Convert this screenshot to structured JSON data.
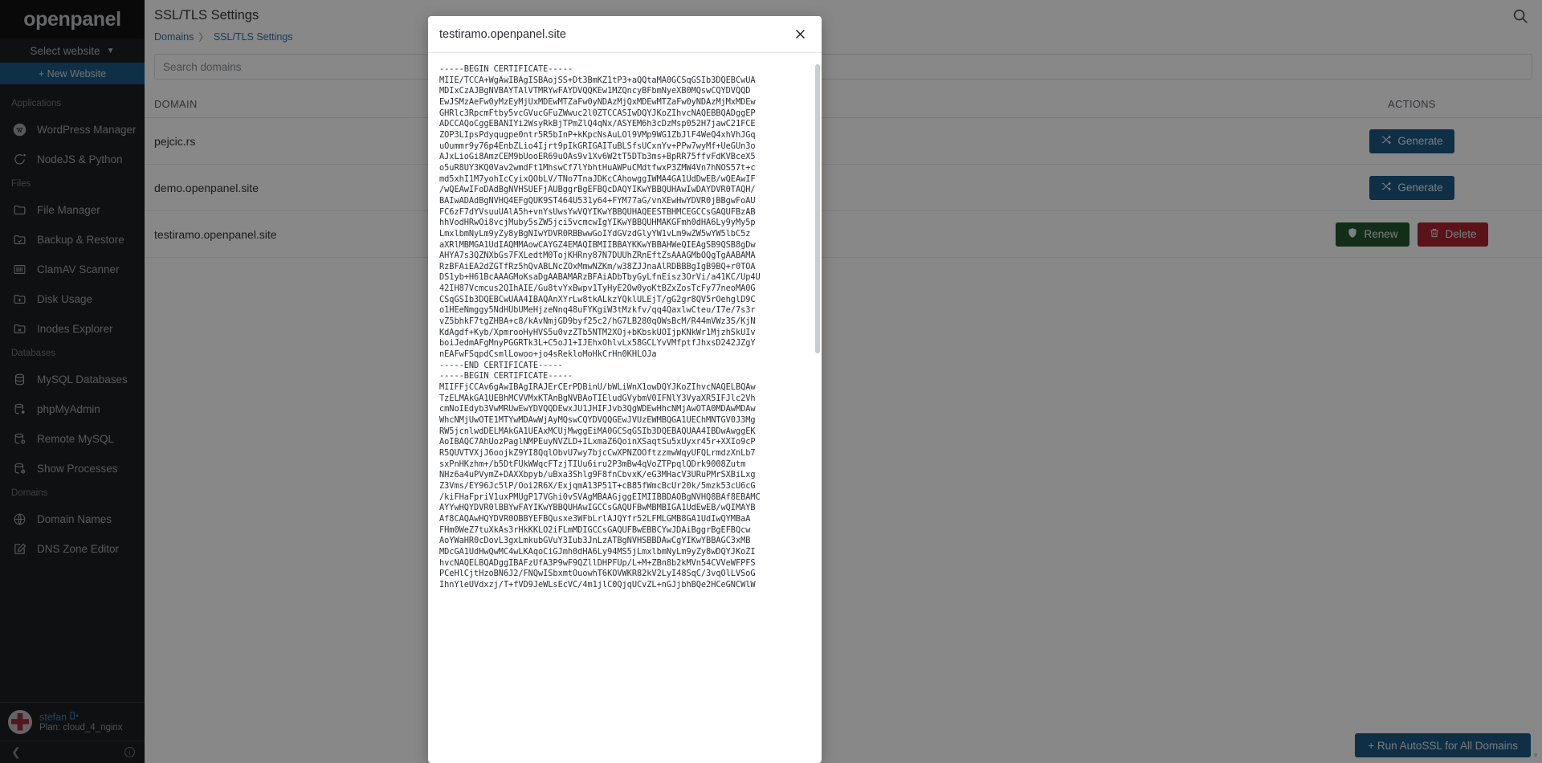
{
  "brand": {
    "name": "openpanel"
  },
  "sidebar": {
    "select_website": "Select website",
    "new_website": "+ New Website",
    "groups": [
      {
        "label": "Applications",
        "items": [
          {
            "label": "WordPress Manager",
            "icon": "wordpress-icon"
          },
          {
            "label": "NodeJS & Python",
            "icon": "nodejs-icon"
          }
        ]
      },
      {
        "label": "Files",
        "items": [
          {
            "label": "File Manager",
            "icon": "folder-icon"
          },
          {
            "label": "Backup & Restore",
            "icon": "folder-check-icon"
          },
          {
            "label": "ClamAV Scanner",
            "icon": "scan-icon"
          },
          {
            "label": "Disk Usage",
            "icon": "folder-plus-icon"
          },
          {
            "label": "Inodes Explorer",
            "icon": "folder-x-icon"
          }
        ]
      },
      {
        "label": "Databases",
        "items": [
          {
            "label": "MySQL Databases",
            "icon": "database-icon"
          },
          {
            "label": "phpMyAdmin",
            "icon": "database-gear-icon"
          },
          {
            "label": "Remote MySQL",
            "icon": "database-alert-icon"
          },
          {
            "label": "Show Processes",
            "icon": "database-ban-icon"
          }
        ]
      },
      {
        "label": "Domains",
        "items": [
          {
            "label": "Domain Names",
            "icon": "globe-icon"
          },
          {
            "label": "DNS Zone Editor",
            "icon": "edit-square-icon"
          }
        ]
      }
    ],
    "user": {
      "name": "stefan",
      "plan": "Plan: cloud_4_nginx",
      "logout_icon": "logout-icon"
    },
    "collapse_icon": "chevron-left-icon",
    "info_icon": "info-icon"
  },
  "header": {
    "title": "SSL/TLS Settings",
    "breadcrumb": [
      "Domains",
      "SSL/TLS Settings"
    ],
    "breadcrumb_separator": "〉",
    "search_icon": "search-icon"
  },
  "search": {
    "placeholder": "Search domains",
    "value": ""
  },
  "table": {
    "columns": [
      "DOMAIN",
      "ACTIONS"
    ],
    "rows": [
      {
        "domain": "pejcic.rs",
        "actions": [
          {
            "label": "Generate",
            "type": "generate",
            "icon": "shuffle-icon"
          }
        ]
      },
      {
        "domain": "demo.openpanel.site",
        "actions": [
          {
            "label": "Generate",
            "type": "generate",
            "icon": "shuffle-icon"
          }
        ]
      },
      {
        "domain": "testiramo.openpanel.site",
        "actions": [
          {
            "label": "Renew",
            "type": "renew",
            "icon": "shield-icon"
          },
          {
            "label": "Delete",
            "type": "delete",
            "icon": "trash-icon"
          }
        ]
      }
    ]
  },
  "footer": {
    "autossl_label": "+ Run AutoSSL for All Domains"
  },
  "modal": {
    "title": "testiramo.openpanel.site",
    "close_icon": "close-icon",
    "certificate": "-----BEGIN CERTIFICATE-----\nMIIE/TCCA+WgAwIBAgISBAojSS+Dt3BmKZ1tP3+aQQtaMA0GCSqGSIb3DQEBCwUA\nMDIxCzAJBgNVBAYTAlVTMRYwFAYDVQQKEw1MZQncyBFbmNyeXB0MQswCQYDVQQD\nEwJSMzAeFw0yMzEyMjUxMDEwMTZaFw0yNDAzMjQxMDEwMTZaFw0yNDAzMjMxMDEw\nGHRlc3RpcmFtby5vcGVucGFuZWwuc2l0ZTCCASIwDQYJKoZIhvcNAQEBBQADggEP\nADCCAQoCggEBANIYi2WsyRkBjTPmZlQ4qNx/ASYEM6h3cDzMsp052H7jawC21FCE\nZOP3LIpsPdyqugpe0ntr5R5bInP+kKpcNsAuLOl9VMp9WG1ZbJlF4WeQ4xhVhJGq\nuOummr9y76p4EnbZLio4Ijrt9pIkGRIGAITuBLSfsUCxnYv+PPw7wyMf+UeGUn3o\nAJxLioGi8AmzCEM9bUooER69uOAs9v1Xv6W2tT5DTb3ms+BpRR75ffvFdKVBceX5\no5uR8UY3KQ0Vav2wmdFt1MhswCf7lYbhtHuAWPuCMdtfwxP3ZMW4Vn7hNOS57t+c\nmd5xhI1M7yohIcCyixQObLV/TNo7TnaJDKcCAhowggIWMA4GA1UdDwEB/wQEAwIF\n/wQEAwIFoDAdBgNVHSUEFjAUBggrBgEFBQcDAQYIKwYBBQUHAwIwDAYDVR0TAQH/\nBAIwADAdBgNVHQ4EFgQUK9ST464U531y64+FYM77aG/vnXEwHwYDVR0jBBgwFoAU\nFC6zF7dYVsuuUAlA5h+vnYsUwsYwVQYIKwYBBQUHAQEESTBHMCEGCCsGAQUFBzAB\nhhVodHRwOi8vcjMuby5sZW5jci5vcmcwIgYIKwYBBQUHMAKGFmh0dHA6Ly9yMy5p\nLmxlbmNyLm9yZy8yBgNIwYDVR0RBBwwGoIYdGVzdGlyYW1vLm9wZW5wYW5lbC5z\naXRlMBMGA1UdIAQMMAowCAYGZ4EMAQIBMIIBBAYKKwYBBAHWeQIEAgSB9QSB8gDw\nAHYA7s3QZNXbGs7FXLedtM0TojKHRny87N7DUUhZRnEftZsAAAGMbOQgTgAABAMA\nRzBFAiEA2dZGTfRz5hQvABLNcZOxMmwNZKm/w38ZJJnaAlRDBBBgIgB9BQ+r0TOA\nDS1yb+H61BcAAAGMoKsaDgAABAMARzBFAiADbTbyGyLfnEisz3OrVi/a41KC/Up4U\n42IH87Vcmcus2QIhAIE/Gu8tvYxBwpv1TyHyE2Ow0yoKtBZxZosTcFy77neoMA0G\nCSqGSIb3DQEBCwUAA4IBAQAnXYrLw8tkALkzYQklULEjT/gG2gr8QV5rOehglD9C\no1HEeNmggy5NdHUbUMeHjzeNnq48uFYKgiW3tMzkfv/qq4QaxlwCteu/I7e/7s3r\nvZ5bhkF7tgZHBA+c8/kAvNmjGD9byf25c2/hG7LB280qOWsBcM/R44mVWz3S/KjN\nKdAgdf+Kyb/XpmrooHyHVS5u0vzZTb5NTM2XOj+bKbskUOIjpKNkWr1MjzhSkUIv\nboiJedmAFgMnyPGGRTk3L+C5oJ1+IJEhxOhlvLx58GCLYvVMfptfJhxsD242JZgY\nnEAFwFSqpdCsmlLowoo+jo4sRekloMoHkCrHn0KHLOJa\n-----END CERTIFICATE-----\n-----BEGIN CERTIFICATE-----\nMIIFFjCCAv6gAwIBAgIRAJErCErPDBinU/bWLiWnX1owDQYJKoZIhvcNAQELBQAw\nTzELMAkGA1UEBhMCVVMxKTAnBgNVBAoTIEludGVybmV0IFNlY3VyaXR5IFJlc2Vh\ncmNoIEdyb3VwMRUwEwYDVQQDEwxJU1JHIFJvb3QgWDEwHhcNMjAwOTA0MDAwMDAw\nWhcNMjUwOTE1MTYwMDAwWjAyMQswCQYDVQQGEwJVUzEWMBQGA1UEChMNTGV0J3Mg\nRW5jcnlwdDELMAkGA1UEAxMCUjMwggEiMA0GCSqGSIb3DQEBAQUAA4IBDwAwggEK\nAoIBAQC7AhUozPaglNMPEuyNVZLD+ILxmaZ6QoinXSaqtSu5xUyxr45r+XXIo9cP\nR5QUVTVXjJ6oojkZ9YI8QqlObvU7wy7bjcCwXPNZOOftzzmwWqyUFQLrmdzXnLb7\nsxPnHKzhm+/b5DtFUkWWqcFTzjTIUu6iru2P3mBw4qVoZTPpqlQDrk9008Zutm\nNHz6a4uPVymZ+DAXXbpyb/uBxa3Shlg9F8fnCbvxK/eG3MHacV3URuPMrSXBiLxg\nZ3Vms/EY96Jc5lP/Ooi2R6X/ExjqmA13P51T+cB85fWmcBcUr20k/5mzk53cU6cG\n/kiFHaFpriV1uxPMUgP17VGhi0vSVAgMBAAGjggEIMIIBBDAOBgNVHQ8BAf8EBAMC\nAYYwHQYDVR0lBBYwFAYIKwYBBQUHAwIGCCsGAQUFBwMBMBIGA1UdEwEB/wQIMAYB\nAf8CAQAwHQYDVR0OBBYEFBQusxe3WFbLrlAJQYfr52LFMLGMB8GA1UdIwQYMBaA\nFHm0WeZ7tuXkAs3rHkKKLO2iFLmMDIGCCsGAQUFBwEBBCYwJDAiBggrBgEFBQcw\nAoYWaHR0cDovL3gxLmkubGVuY3Iub3JnLzATBgNVHSBBDAwCgYIKwYBBAGC3xMB\nMDcGA1UdHwQwMC4wLKAqoCiGJmh0dHA6Ly94MS5jLmxlbmNyLm9yZy8wDQYJKoZI\nhvcNAQELBQADggIBAFzUfA3P9wF9QZllDHPFUp/L+M+ZBn8b2kMVn54CVVeWFPFS\nPCeHlCjtHzoBN6J2/FNQwISbxmtOuowhT6KOVWKR82kV2LyI48SqC/3vqOlLVSoG\nIhnYleUVdxzj/T+fVD9JeWLsEcVC/4m1jlC0QjqUCvZL+nGJjbhBQe2HCeGNCWlW\n"
  }
}
